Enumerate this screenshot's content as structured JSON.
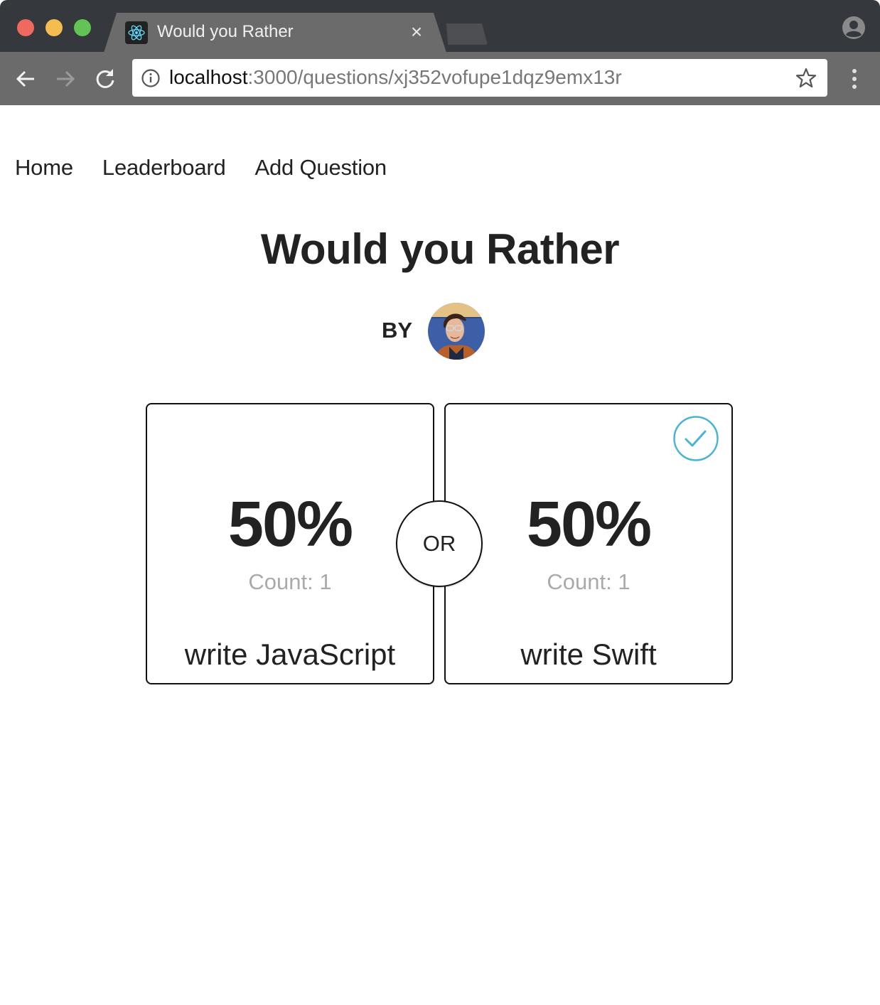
{
  "browser": {
    "tab_title": "Would you Rather",
    "tab_close": "×",
    "url_host": "localhost",
    "url_path": ":3000/questions/xj352vofupe1dqz9emx13r",
    "icons": {
      "favicon": "react-logo-icon",
      "back": "arrow-left-icon",
      "forward": "arrow-right-icon",
      "reload": "reload-icon",
      "info": "info-icon",
      "bookmark": "star-icon",
      "menu": "kebab-menu-icon",
      "profile": "profile-icon"
    }
  },
  "nav": {
    "items": [
      {
        "label": "Home"
      },
      {
        "label": "Leaderboard"
      },
      {
        "label": "Add Question"
      }
    ]
  },
  "question": {
    "title": "Would you Rather",
    "by_label": "BY",
    "author_avatar": "author-avatar",
    "separator": "OR",
    "options": [
      {
        "percent": "50%",
        "count_text": "Count: 1",
        "text": "write JavaScript",
        "selected": false
      },
      {
        "percent": "50%",
        "count_text": "Count: 1",
        "text": "write Swift",
        "selected": true
      }
    ]
  },
  "colors": {
    "accent": "#4db3d3",
    "muted_text": "#aaaaaa",
    "text": "#222222"
  }
}
